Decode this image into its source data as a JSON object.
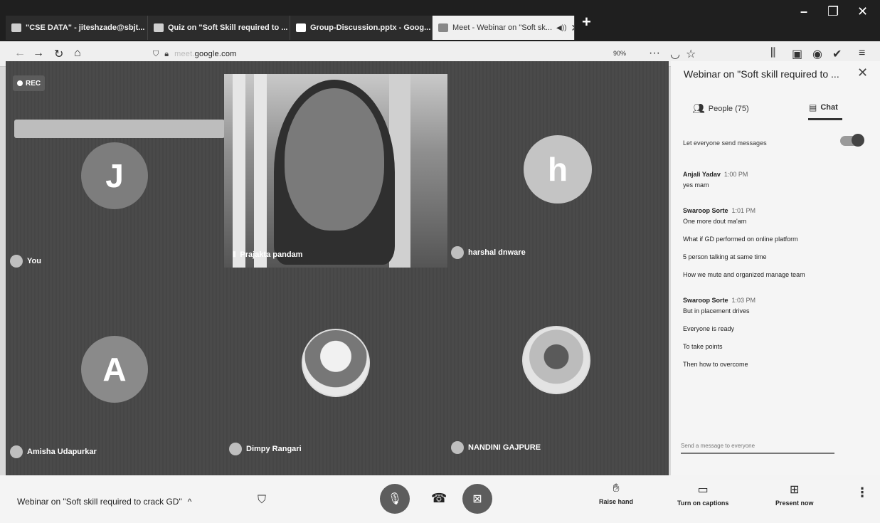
{
  "browser": {
    "tabs": [
      {
        "label": "\"CSE DATA\" - jiteshzade@sbjt..."
      },
      {
        "label": "Quiz on \"Soft Skill required to ..."
      },
      {
        "label": "Group-Discussion.pptx - Goog..."
      },
      {
        "label": "Meet - Webinar on \"Soft sk..."
      }
    ],
    "new_tab": "+",
    "url": "google.com",
    "zoom": "90%"
  },
  "stage": {
    "rec_label": "REC",
    "tiles": [
      {
        "name": "You",
        "initial": "J",
        "color": "#7d7d7d"
      },
      {
        "name": "Prajakta pandam",
        "type": "video"
      },
      {
        "name": "harshal dnware",
        "initial": "h",
        "color": "#c4c4c4"
      },
      {
        "name": "Amisha Udapurkar",
        "initial": "A",
        "color": "#8a8a8a"
      },
      {
        "name": "Dimpy Rangari",
        "type": "photo"
      },
      {
        "name": "NANDINI GAJPURE",
        "type": "photo"
      }
    ]
  },
  "panel": {
    "title": "Webinar on \"Soft skill required to ...",
    "tabs": {
      "people": "People (75)",
      "chat": "Chat"
    },
    "permission_label": "Let everyone send messages",
    "messages": [
      {
        "sender": "Anjali Yadav",
        "time": "1:00 PM",
        "lines": [
          "yes mam"
        ]
      },
      {
        "sender": "Swaroop Sorte",
        "time": "1:01 PM",
        "lines": [
          "One more dout ma'am",
          "What if GD performed on online platform",
          "5 person talking at same time",
          "How we mute and organized manage team"
        ]
      },
      {
        "sender": "Swaroop Sorte",
        "time": "1:03 PM",
        "lines": [
          "But in placement drives",
          "Everyone is ready",
          "To take points",
          "Then how to overcome"
        ]
      }
    ],
    "compose_placeholder": "Send a message to everyone"
  },
  "bottom": {
    "meeting_title": "Webinar on \"Soft skill required to crack GD\"",
    "raise_hand": "Raise hand",
    "captions": "Turn on captions",
    "present": "Present now"
  }
}
